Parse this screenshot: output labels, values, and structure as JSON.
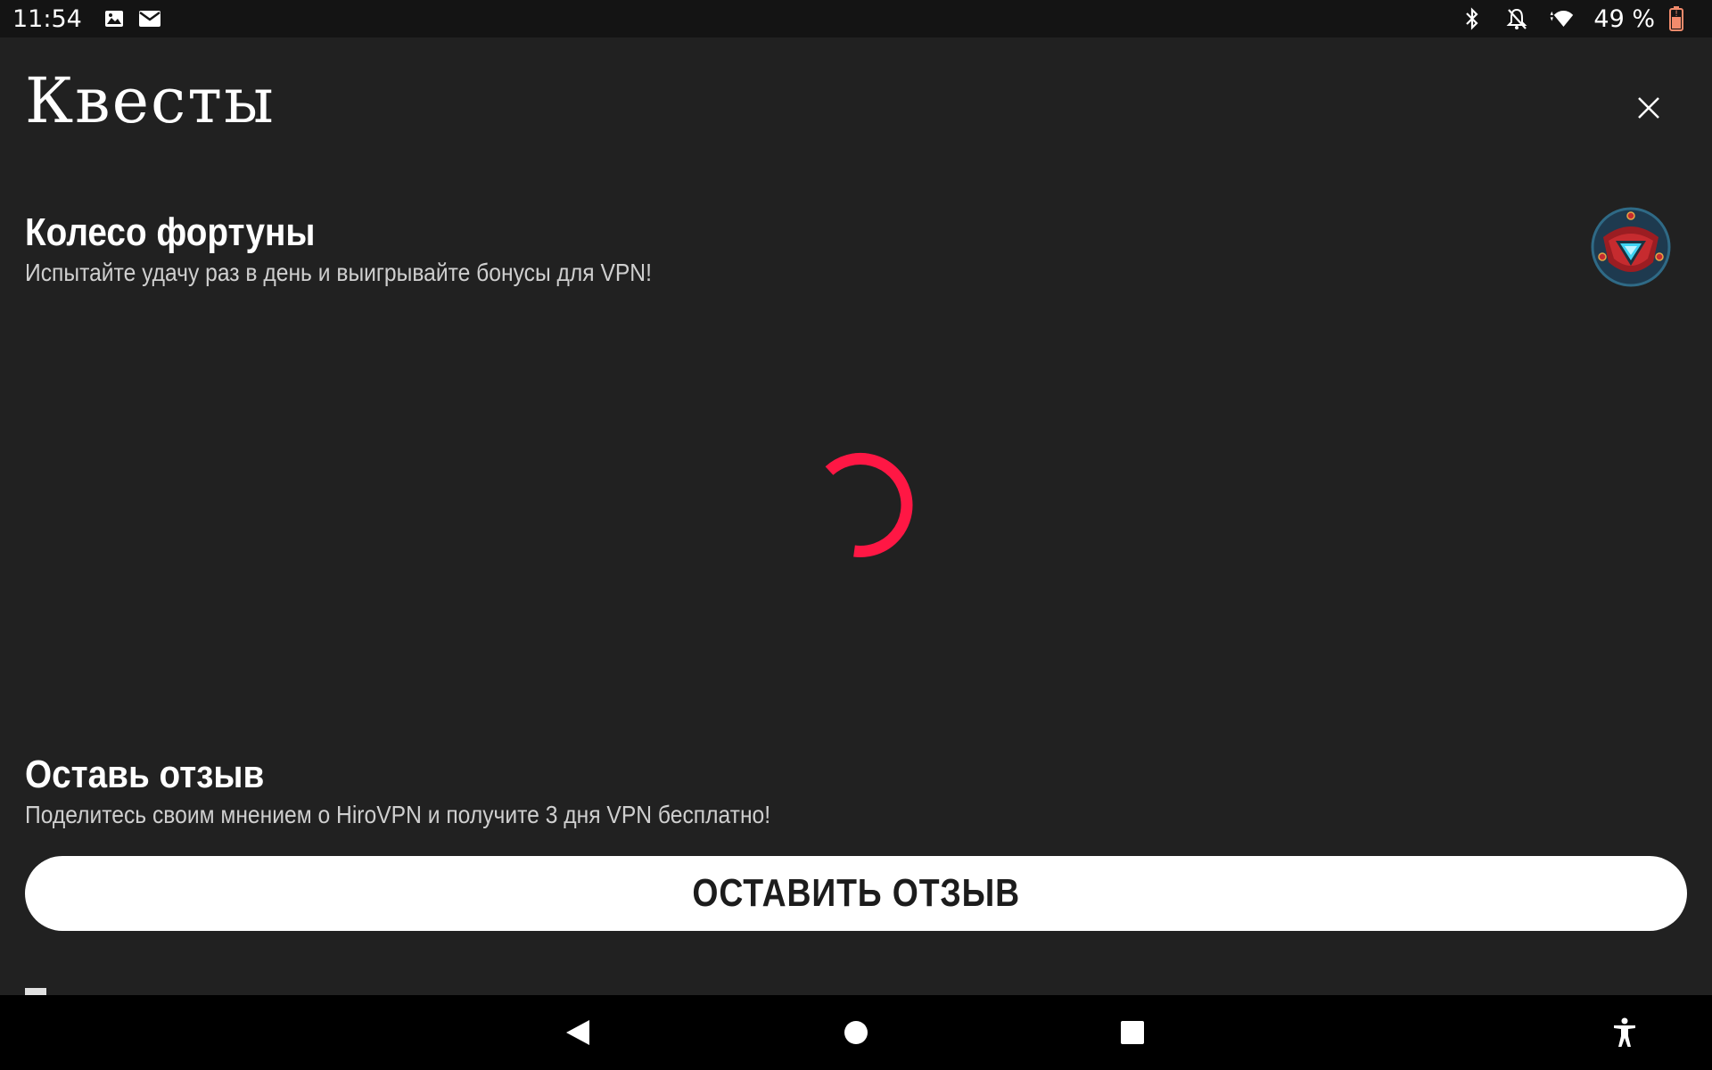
{
  "status_bar": {
    "time": "11:54",
    "battery_text": "49 %",
    "icons_left": [
      "image-icon",
      "mail-icon"
    ],
    "icons_right": [
      "bluetooth-icon",
      "bell-off-icon",
      "wifi-icon",
      "battery-icon"
    ]
  },
  "header": {
    "title": "Квесты",
    "close_icon": "close-icon"
  },
  "sections": {
    "wheel": {
      "title": "Колесо фортуны",
      "subtitle": "Испытайте удачу раз в день и выигрывайте бонусы для VPN!",
      "state": "loading"
    },
    "review": {
      "title": "Оставь отзыв",
      "subtitle": "Поделитесь своим мнением о HiroVPN и получите 3 дня VPN бесплатно!",
      "button_label": "ОСТАВИТЬ ОТЗЫВ"
    }
  },
  "colors": {
    "background": "#212121",
    "spinner": "#ff1744",
    "button_bg": "#ffffff",
    "button_text": "#1c1c1c"
  },
  "nav_bar": {
    "buttons": [
      "back-icon",
      "home-icon",
      "recents-icon",
      "accessibility-icon"
    ]
  }
}
